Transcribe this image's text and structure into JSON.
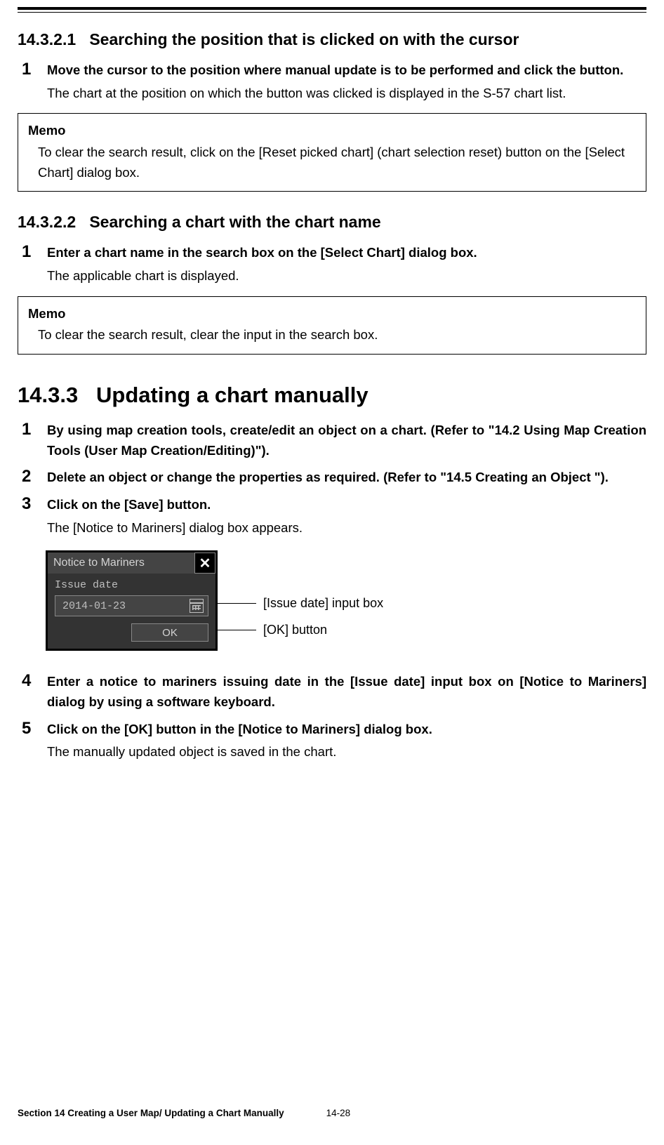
{
  "sec1": {
    "num": "14.3.2.1",
    "title": "Searching the position that is clicked on with the cursor",
    "step1": {
      "n": "1",
      "title": "Move the cursor to the position where manual update is to be performed and click the button.",
      "desc": "The chart at the position on which the button was clicked is displayed in the S-57 chart list."
    },
    "memo": {
      "title": "Memo",
      "body": "To clear the search result, click on the [Reset picked chart] (chart selection reset) button on the [Select Chart] dialog box."
    }
  },
  "sec2": {
    "num": "14.3.2.2",
    "title": "Searching a chart with the chart name",
    "step1": {
      "n": "1",
      "title": "Enter a chart name in the search box on the [Select Chart] dialog box.",
      "desc": "The applicable chart is displayed."
    },
    "memo": {
      "title": "Memo",
      "body": "To clear the search result, clear the input in the search box."
    }
  },
  "sec3": {
    "num": "14.3.3",
    "title": "Updating a chart manually",
    "step1": {
      "n": "1",
      "title": "By using map creation tools, create/edit an object on a chart. (Refer to \"14.2 Using Map Creation Tools (User Map Creation/Editing)\")."
    },
    "step2": {
      "n": "2",
      "title": "Delete an object or change the properties as required. (Refer to \"14.5 Creating an Object \")."
    },
    "step3": {
      "n": "3",
      "title": "Click on the [Save] button.",
      "desc": "The [Notice to Mariners] dialog box appears."
    },
    "dialog": {
      "title": "Notice to Mariners",
      "label": "Issue date",
      "date": "2014-01-23",
      "ok": "OK"
    },
    "callout1": "[Issue date] input box",
    "callout2": "[OK] button",
    "step4": {
      "n": "4",
      "title": "Enter a notice to mariners issuing date in the [Issue date] input box on [Notice to Mariners] dialog by using a software keyboard."
    },
    "step5": {
      "n": "5",
      "title": "Click on the [OK] button in the [Notice to Mariners] dialog box.",
      "desc": "The manually updated object is saved in the chart."
    }
  },
  "footer": {
    "section": "Section 14    Creating a User Map/ Updating a Chart Manually",
    "page": "14-28"
  }
}
